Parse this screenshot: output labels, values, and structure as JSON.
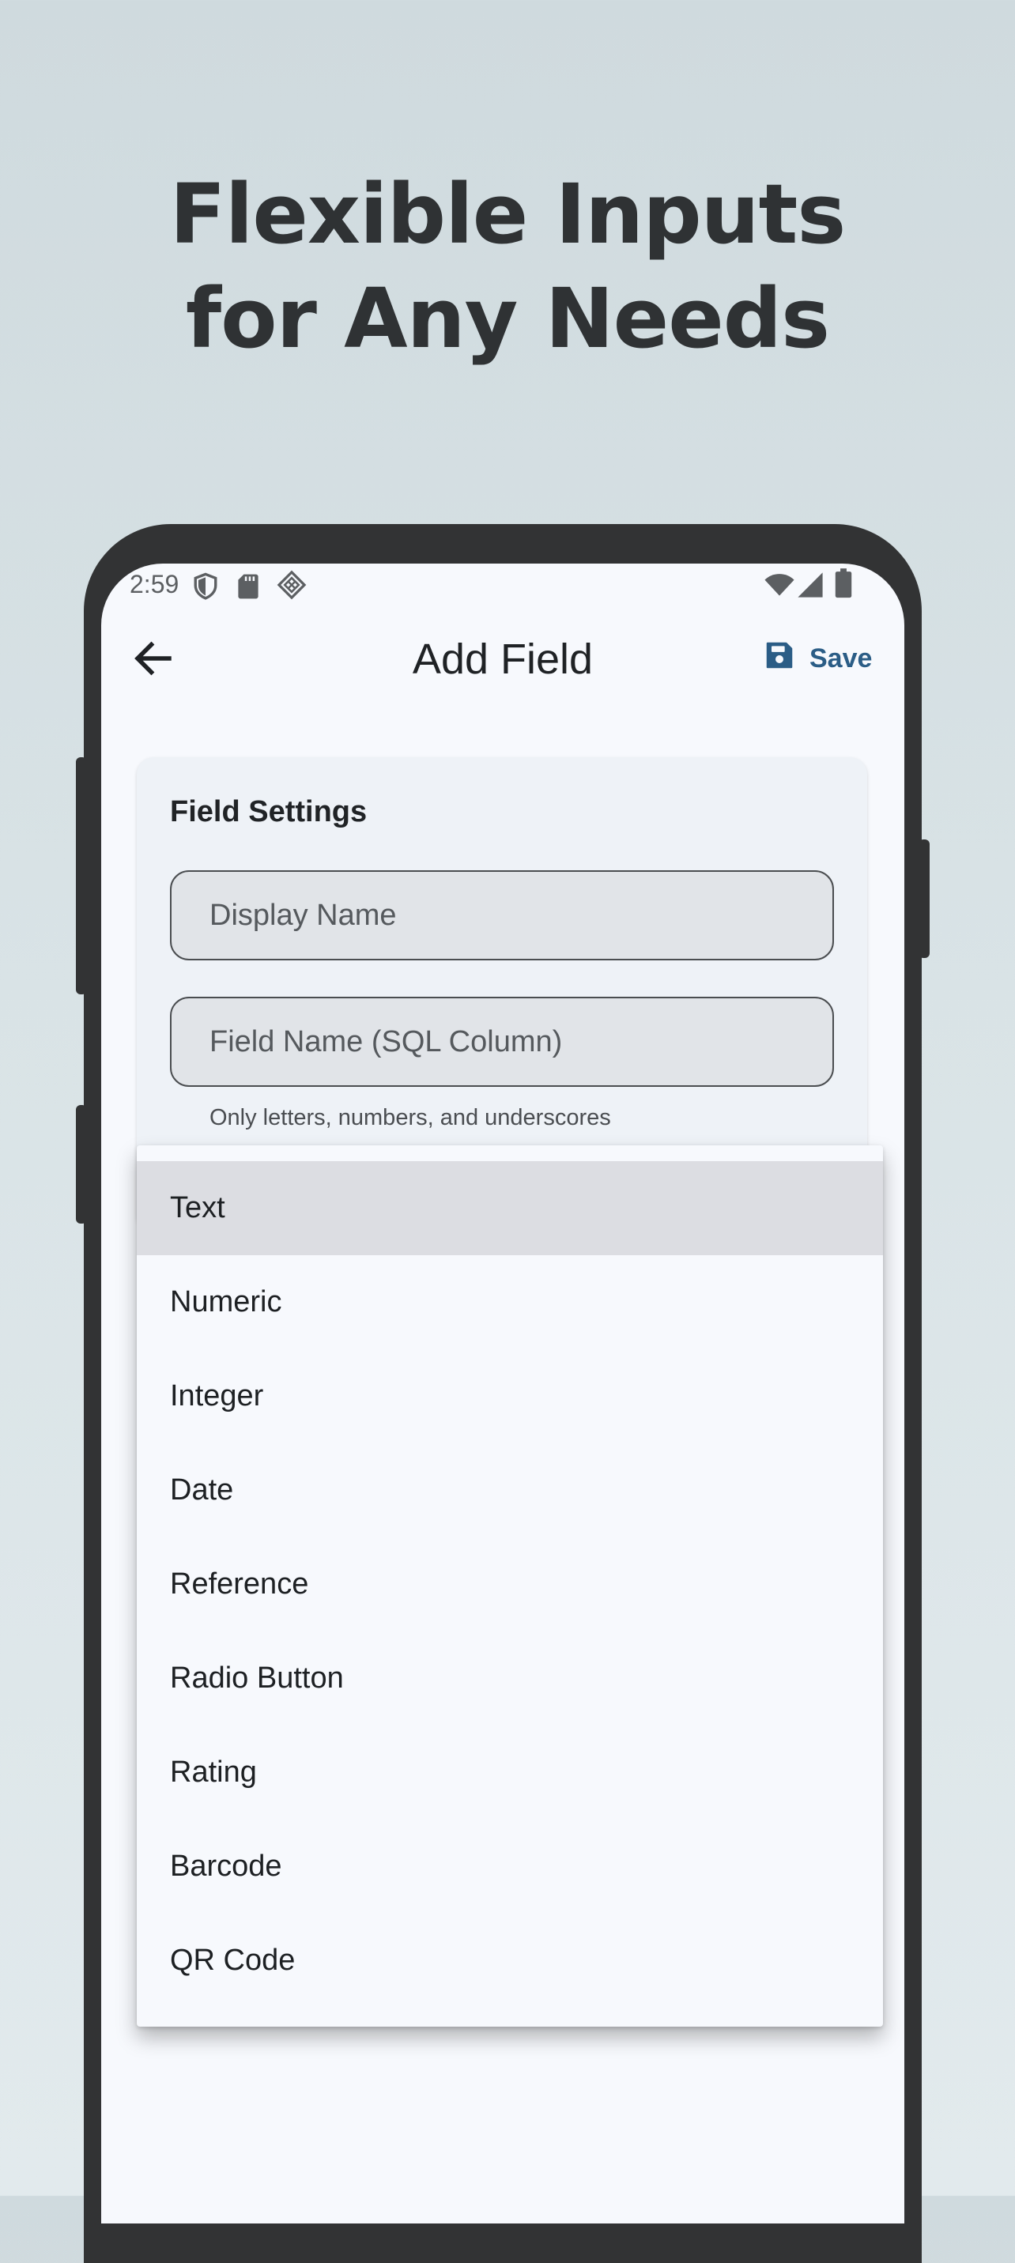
{
  "headline": {
    "line1": "Flexible Inputs",
    "line2": "for Any Needs"
  },
  "status_bar": {
    "time": "2:59",
    "left_icons": [
      "shield-icon",
      "sd-card-icon",
      "cast-diamond-icon"
    ],
    "right_icons": [
      "wifi-icon",
      "signal-icon",
      "battery-icon"
    ]
  },
  "app_bar": {
    "back_icon": "arrow-left-icon",
    "title": "Add Field",
    "save_icon": "floppy-disk-icon",
    "save_label": "Save"
  },
  "field_settings": {
    "title": "Field Settings",
    "display_name_placeholder": "Display Name",
    "field_name_placeholder": "Field Name (SQL Column)",
    "field_name_helper": "Only letters, numbers, and underscores"
  },
  "type_menu": {
    "selected": "Text",
    "items": [
      "Text",
      "Numeric",
      "Integer",
      "Date",
      "Reference",
      "Radio Button",
      "Rating",
      "Barcode",
      "QR Code"
    ]
  },
  "colors": {
    "background": "#d5dfe2",
    "headline": "#2f3234",
    "phone_frame": "#323334",
    "screen": "#f7f9fd",
    "accent": "#2b5d86",
    "selected_item": "#dcdde2"
  }
}
